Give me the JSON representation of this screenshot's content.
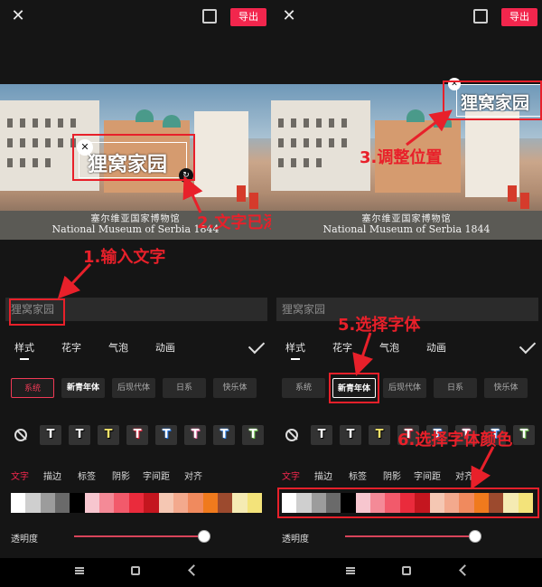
{
  "left": {
    "header": {
      "export_label": "导出"
    },
    "video": {
      "overlay_text": "狸窝家园",
      "caption_cn": "塞尔维亚国家博物馆",
      "caption_en": "National Museum of Serbia 1844"
    },
    "annotations": {
      "step1": "1.输入文字",
      "step2": "2.文字已添加"
    },
    "input": {
      "value": "狸窝家园"
    },
    "tabs": [
      "样式",
      "花字",
      "气泡",
      "动画"
    ],
    "fonts": [
      "系统",
      "新青年体",
      "后现代体",
      "日系",
      "快乐体"
    ],
    "subtabs": [
      "文字",
      "描边",
      "标签",
      "阴影",
      "字间距",
      "对齐"
    ],
    "opacity_label": "透明度"
  },
  "right": {
    "header": {
      "export_label": "导出"
    },
    "video": {
      "overlay_text": "狸窝家园",
      "caption_cn": "塞尔维亚国家博物馆",
      "caption_en": "National Museum of Serbia 1844"
    },
    "annotations": {
      "step3": "3.调整位置",
      "step5": "5.选择字体",
      "step6": "6.选择字体颜色"
    },
    "input": {
      "value": "狸窝家园"
    },
    "tabs": [
      "样式",
      "花字",
      "气泡",
      "动画"
    ],
    "fonts": [
      "系统",
      "新青年体",
      "后现代体",
      "日系",
      "快乐体"
    ],
    "subtabs": [
      "文字",
      "描边",
      "标签",
      "阴影",
      "字间距",
      "对齐"
    ],
    "opacity_label": "透明度"
  },
  "style_presets": [
    {
      "icon": "no-style-icon"
    },
    {
      "fg": "#ffffff",
      "stroke": "#000000"
    },
    {
      "fg": "#ffffff",
      "stroke": "#000000"
    },
    {
      "fg": "#f3e36a",
      "stroke": "#000000"
    },
    {
      "fg": "#ffffff",
      "stroke": "#e8203a"
    },
    {
      "fg": "#ffffff",
      "stroke": "#1a73e8"
    },
    {
      "fg": "#ffffff",
      "stroke": "#f06ca5"
    },
    {
      "fg": "#ffffff",
      "stroke": "#3a8cf0"
    },
    {
      "fg": "#ffffff",
      "stroke": "#6cc24a"
    }
  ],
  "colors": {
    "accent": "#f2264d",
    "annotation_red": "#e8202a",
    "swatches": [
      "#ffffff",
      "#cfcfcf",
      "#9c9c9c",
      "#6a6a6a",
      "#000000",
      "#f7c6cf",
      "#f48a97",
      "#f25a6b",
      "#ea2b3c",
      "#c4161f",
      "#f5c7b3",
      "#f3a98d",
      "#f08a5e",
      "#f07a1d",
      "#9c4a2e",
      "#f5ebb3",
      "#f3e37a"
    ]
  },
  "opacity_value": 0.95
}
